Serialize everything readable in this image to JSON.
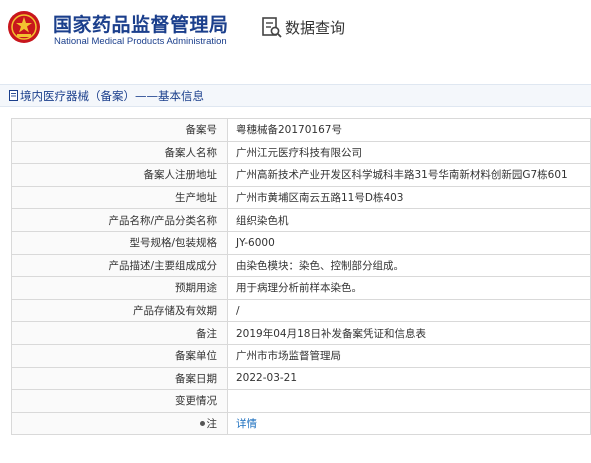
{
  "header": {
    "brand_cn": "国家药品监督管理局",
    "brand_en": "National Medical Products Administration",
    "query_title": "数据查询",
    "brand_color": "#1b3f8c",
    "emblem_color": "#c8161d"
  },
  "breadcrumb": {
    "text": "境内医疗器械（备案）——基本信息",
    "icon": "document-icon"
  },
  "rows": [
    {
      "key": "备案号",
      "value": "粤穗械备20170167号"
    },
    {
      "key": "备案人名称",
      "value": "广州江元医疗科技有限公司"
    },
    {
      "key": "备案人注册地址",
      "value": "广州高新技术产业开发区科学城科丰路31号华南新材料创新园G7栋601"
    },
    {
      "key": "生产地址",
      "value": "广州市黄埔区南云五路11号D栋403"
    },
    {
      "key": "产品名称/产品分类名称",
      "value": "组织染色机"
    },
    {
      "key": "型号规格/包装规格",
      "value": "JY-6000"
    },
    {
      "key": "产品描述/主要组成成分",
      "value": "由染色模块：染色、控制部分组成。"
    },
    {
      "key": "预期用途",
      "value": "用于病理分析前样本染色。"
    },
    {
      "key": "产品存储及有效期",
      "value": "/"
    },
    {
      "key": "备注",
      "value": "2019年04月18日补发备案凭证和信息表"
    },
    {
      "key": "备案单位",
      "value": "广州市市场监督管理局"
    },
    {
      "key": "备案日期",
      "value": "2022-03-21"
    },
    {
      "key": "变更情况",
      "value": ""
    },
    {
      "key": "注",
      "value": "详情",
      "link": true
    }
  ]
}
